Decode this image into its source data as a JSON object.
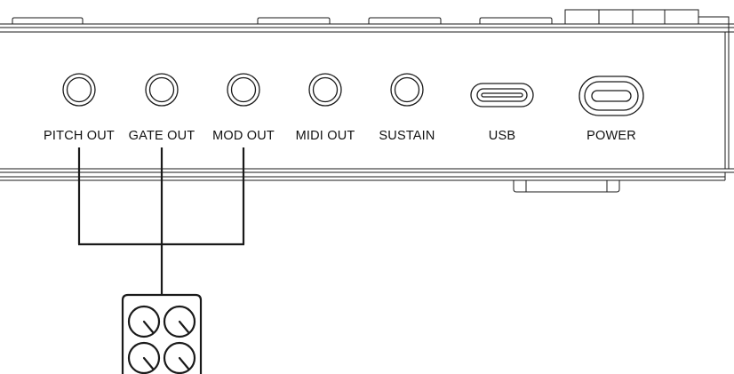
{
  "ports": [
    {
      "label": "PITCH OUT",
      "kind": "jack"
    },
    {
      "label": "GATE OUT",
      "kind": "jack"
    },
    {
      "label": "MOD OUT",
      "kind": "jack"
    },
    {
      "label": "MIDI OUT",
      "kind": "jack"
    },
    {
      "label": "SUSTAIN",
      "kind": "jack"
    },
    {
      "label": "USB",
      "kind": "usb-c"
    },
    {
      "label": "POWER",
      "kind": "power"
    }
  ],
  "connections": [
    "PITCH OUT",
    "GATE OUT",
    "MOD OUT"
  ],
  "external_device": {
    "icon": "modular-synth-knobs-icon",
    "knob_count": 4
  },
  "colors": {
    "line": "#1a1a1a",
    "background": "#ffffff"
  }
}
